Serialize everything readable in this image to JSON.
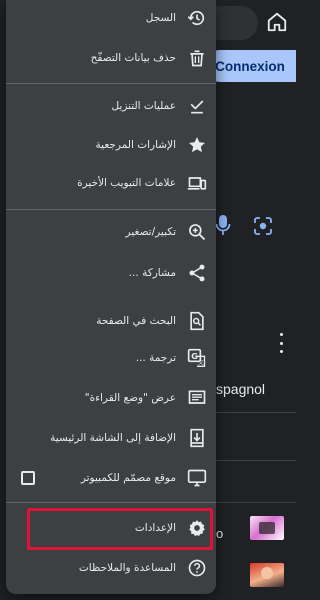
{
  "background_page": {
    "connexion_button": "Connexion",
    "result_text": "spagnol",
    "snippet_text": "o"
  },
  "menu": {
    "items": [
      {
        "label": "السجل",
        "icon": "history-icon"
      },
      {
        "label": "حذف بيانات التصفّح",
        "icon": "trash-icon"
      },
      {
        "label": "عمليات التنزيل",
        "icon": "download-check-icon"
      },
      {
        "label": "الإشارات المرجعية",
        "icon": "star-icon"
      },
      {
        "label": "علامات التبويب الأخيرة",
        "icon": "devices-icon"
      },
      {
        "label": "تكبير/تصغير",
        "icon": "zoom-in-icon"
      },
      {
        "label": "مشاركة ...",
        "icon": "share-icon"
      },
      {
        "label": "البحث في الصفحة",
        "icon": "find-in-page-icon"
      },
      {
        "label": "ترجمة ...",
        "icon": "translate-icon"
      },
      {
        "label": "عرض \"وضع القراءة\"",
        "icon": "reader-mode-icon"
      },
      {
        "label": "الإضافة إلى الشاشة الرئيسية",
        "icon": "add-to-home-icon"
      },
      {
        "label": "موقع مصمّم للكمبيوتر",
        "icon": "desktop-icon",
        "checked": false
      },
      {
        "label": "الإعدادات",
        "icon": "settings-icon",
        "highlighted": true
      },
      {
        "label": "المساعدة والملاحظات",
        "icon": "help-icon"
      }
    ]
  },
  "colors": {
    "menu_background": "#3c4043",
    "page_background": "#202124",
    "highlight": "#e0123a",
    "accent_button": "#a8c7fa"
  }
}
